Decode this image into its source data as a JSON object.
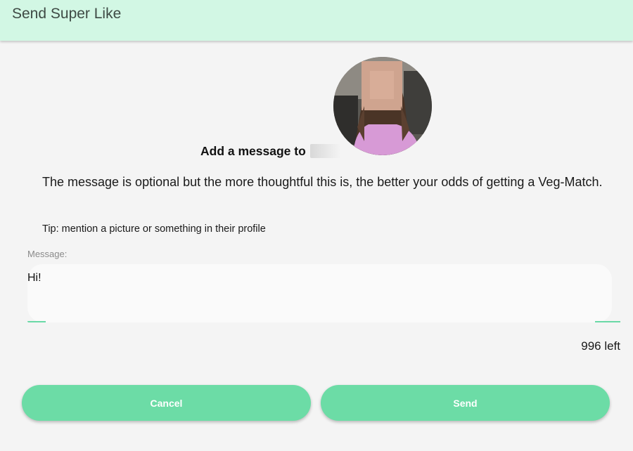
{
  "appbar": {
    "title": "Send Super Like"
  },
  "recipient": {
    "prompt": "Add a message to"
  },
  "description": "The message is optional but the more thoughtful this is, the better your odds of getting a Veg-Match.",
  "tip": "Tip: mention a picture or something in their profile",
  "message": {
    "label": "Message:",
    "value": "Hi!",
    "chars_left": "996 left"
  },
  "actions": {
    "cancel": "Cancel",
    "send": "Send"
  },
  "colors": {
    "appbar_bg": "#d2f7e4",
    "accent": "#6cdca6"
  }
}
